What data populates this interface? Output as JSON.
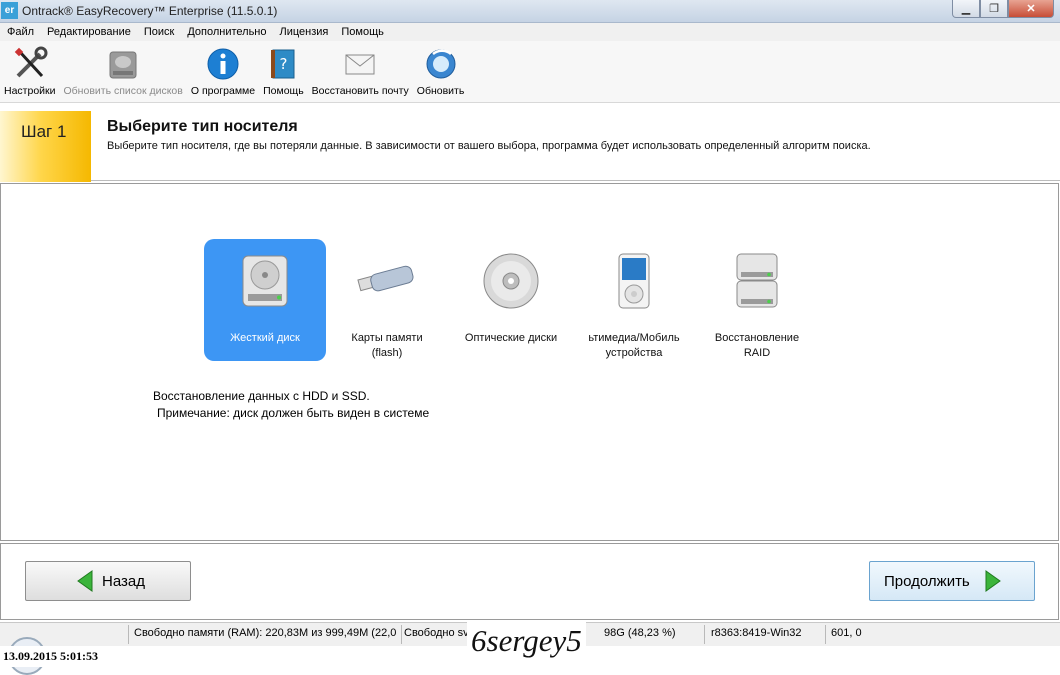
{
  "window": {
    "app_icon_text": "er",
    "title": "Ontrack® EasyRecovery™ Enterprise (11.5.0.1)"
  },
  "menu": [
    "Файл",
    "Редактирование",
    "Поиск",
    "Дополнительно",
    "Лицензия",
    "Помощь"
  ],
  "toolbar": {
    "settings": "Настройки",
    "refresh_disks": "Обновить список дисков",
    "about": "О программе",
    "help": "Помощь",
    "restore_mail": "Восстановить почту",
    "update": "Обновить"
  },
  "step": {
    "label": "Шаг 1",
    "title": "Выберите тип носителя",
    "description": "Выберите тип носителя, где вы потеряли данные. В зависимости от вашего выбора, программа будет использовать определенный алгоритм поиска."
  },
  "media": [
    {
      "label": "Жесткий диск",
      "icon": "hard-disk-icon",
      "selected": true
    },
    {
      "label": "Карты памяти (flash)",
      "icon": "usb-flash-icon",
      "selected": false
    },
    {
      "label": "Оптические диски",
      "icon": "optical-disc-icon",
      "selected": false
    },
    {
      "label": "ьтимедиа/Мобиль устройства",
      "icon": "media-player-icon",
      "selected": false
    },
    {
      "label": "Восстановление RAID",
      "icon": "raid-icon",
      "selected": false
    }
  ],
  "media_lines": {
    "card_1": "Карты памяти",
    "card_2": "(flash)",
    "mobile_1": "ьтимедиа/Мобиль",
    "mobile_2": "устройства",
    "raid_1": "Восстановление",
    "raid_2": "RAID"
  },
  "info": {
    "line1": "Восстановление данных с HDD и SSD.",
    "line2": "Примечание: диск должен быть виден в системе"
  },
  "buttons": {
    "back": "Назад",
    "next": "Продолжить"
  },
  "status": {
    "memory": "Свободно памяти (RAM): 220,83M из 999,49M (22,0",
    "free": "Свободно sv",
    "disk": "98G (48,23 %)",
    "build": "r8363:8419-Win32",
    "coords": "601, 0"
  },
  "overlay": {
    "datetime": "13.09.2015 5:01:53",
    "watermark": "6sergey5"
  }
}
